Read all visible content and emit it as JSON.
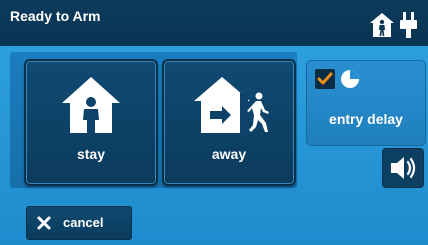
{
  "header": {
    "title": "Ready to Arm",
    "status_icons": [
      "home-person-icon",
      "power-plug-icon"
    ]
  },
  "modes": [
    {
      "label": "stay",
      "icon": "stay-home-icon"
    },
    {
      "label": "away",
      "icon": "away-home-icon"
    }
  ],
  "options": {
    "entry_delay": {
      "label": "entry delay",
      "checked": true,
      "icon": "clock-icon"
    }
  },
  "sound": {
    "icon": "volume-icon"
  },
  "footer": {
    "cancel_label": "cancel",
    "cancel_icon": "close-icon"
  },
  "colors": {
    "header_bg": "#0b3756",
    "screen_bg": "#2a9bdc",
    "button_bg": "#0e4569",
    "check_accent": "#f28c1a",
    "text": "#ffffff"
  }
}
